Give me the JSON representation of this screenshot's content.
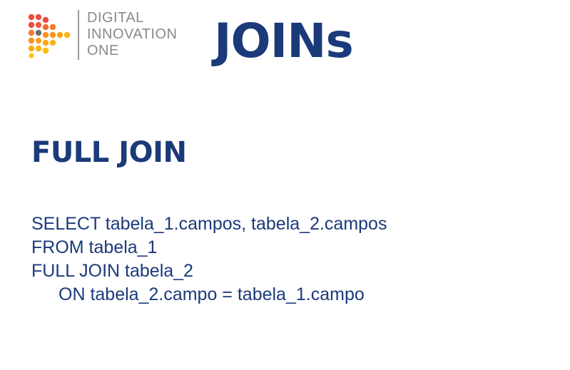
{
  "logo": {
    "lines": [
      "DIGITAL",
      "INNOVATION",
      "ONE"
    ],
    "icon": "dio-dots-play-icon",
    "colors": [
      "#f04a3e",
      "#f7941d",
      "#fcb514",
      "#6d6e71"
    ]
  },
  "title": "JOINs",
  "section": {
    "heading": "FULL JOIN"
  },
  "code": {
    "lines": [
      "SELECT tabela_1.campos, tabela_2.campos",
      "FROM tabela_1",
      "FULL JOIN tabela_2",
      "ON tabela_2.campo = tabela_1.campo"
    ]
  },
  "colors": {
    "text": "#1b3a7a",
    "logo_text": "#8a8a8a",
    "background": "#ffffff"
  }
}
